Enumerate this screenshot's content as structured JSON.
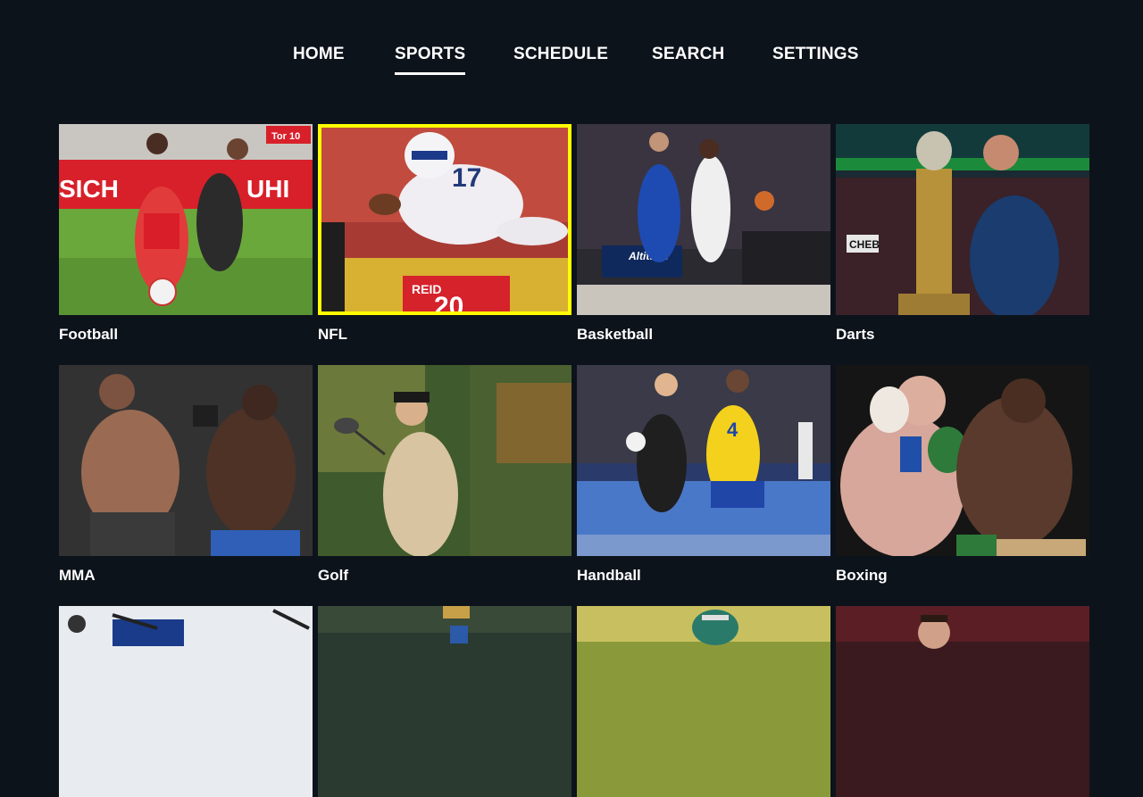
{
  "nav": {
    "items": [
      {
        "label": "HOME",
        "active": false
      },
      {
        "label": "SPORTS",
        "active": true
      },
      {
        "label": "SCHEDULE",
        "active": false
      },
      {
        "label": "SEARCH",
        "active": false
      },
      {
        "label": "SETTINGS",
        "active": false
      }
    ]
  },
  "focus_color": "#ffff00",
  "tiles": [
    {
      "label": "Football",
      "focused": false
    },
    {
      "label": "NFL",
      "focused": true
    },
    {
      "label": "Basketball",
      "focused": false
    },
    {
      "label": "Darts",
      "focused": false
    },
    {
      "label": "MMA",
      "focused": false
    },
    {
      "label": "Golf",
      "focused": false
    },
    {
      "label": "Handball",
      "focused": false
    },
    {
      "label": "Boxing",
      "focused": false
    },
    {
      "label": "",
      "focused": false
    },
    {
      "label": "",
      "focused": false
    },
    {
      "label": "",
      "focused": false
    },
    {
      "label": "",
      "focused": false
    }
  ],
  "photo_text": {
    "nfl_jersey": "17",
    "nfl_defender_name": "REID",
    "nfl_defender_number": "20",
    "darts_sign": "CHEB",
    "basketball_banner": "Altitude",
    "handball_jersey": "4",
    "football_board": "Tor 10"
  }
}
